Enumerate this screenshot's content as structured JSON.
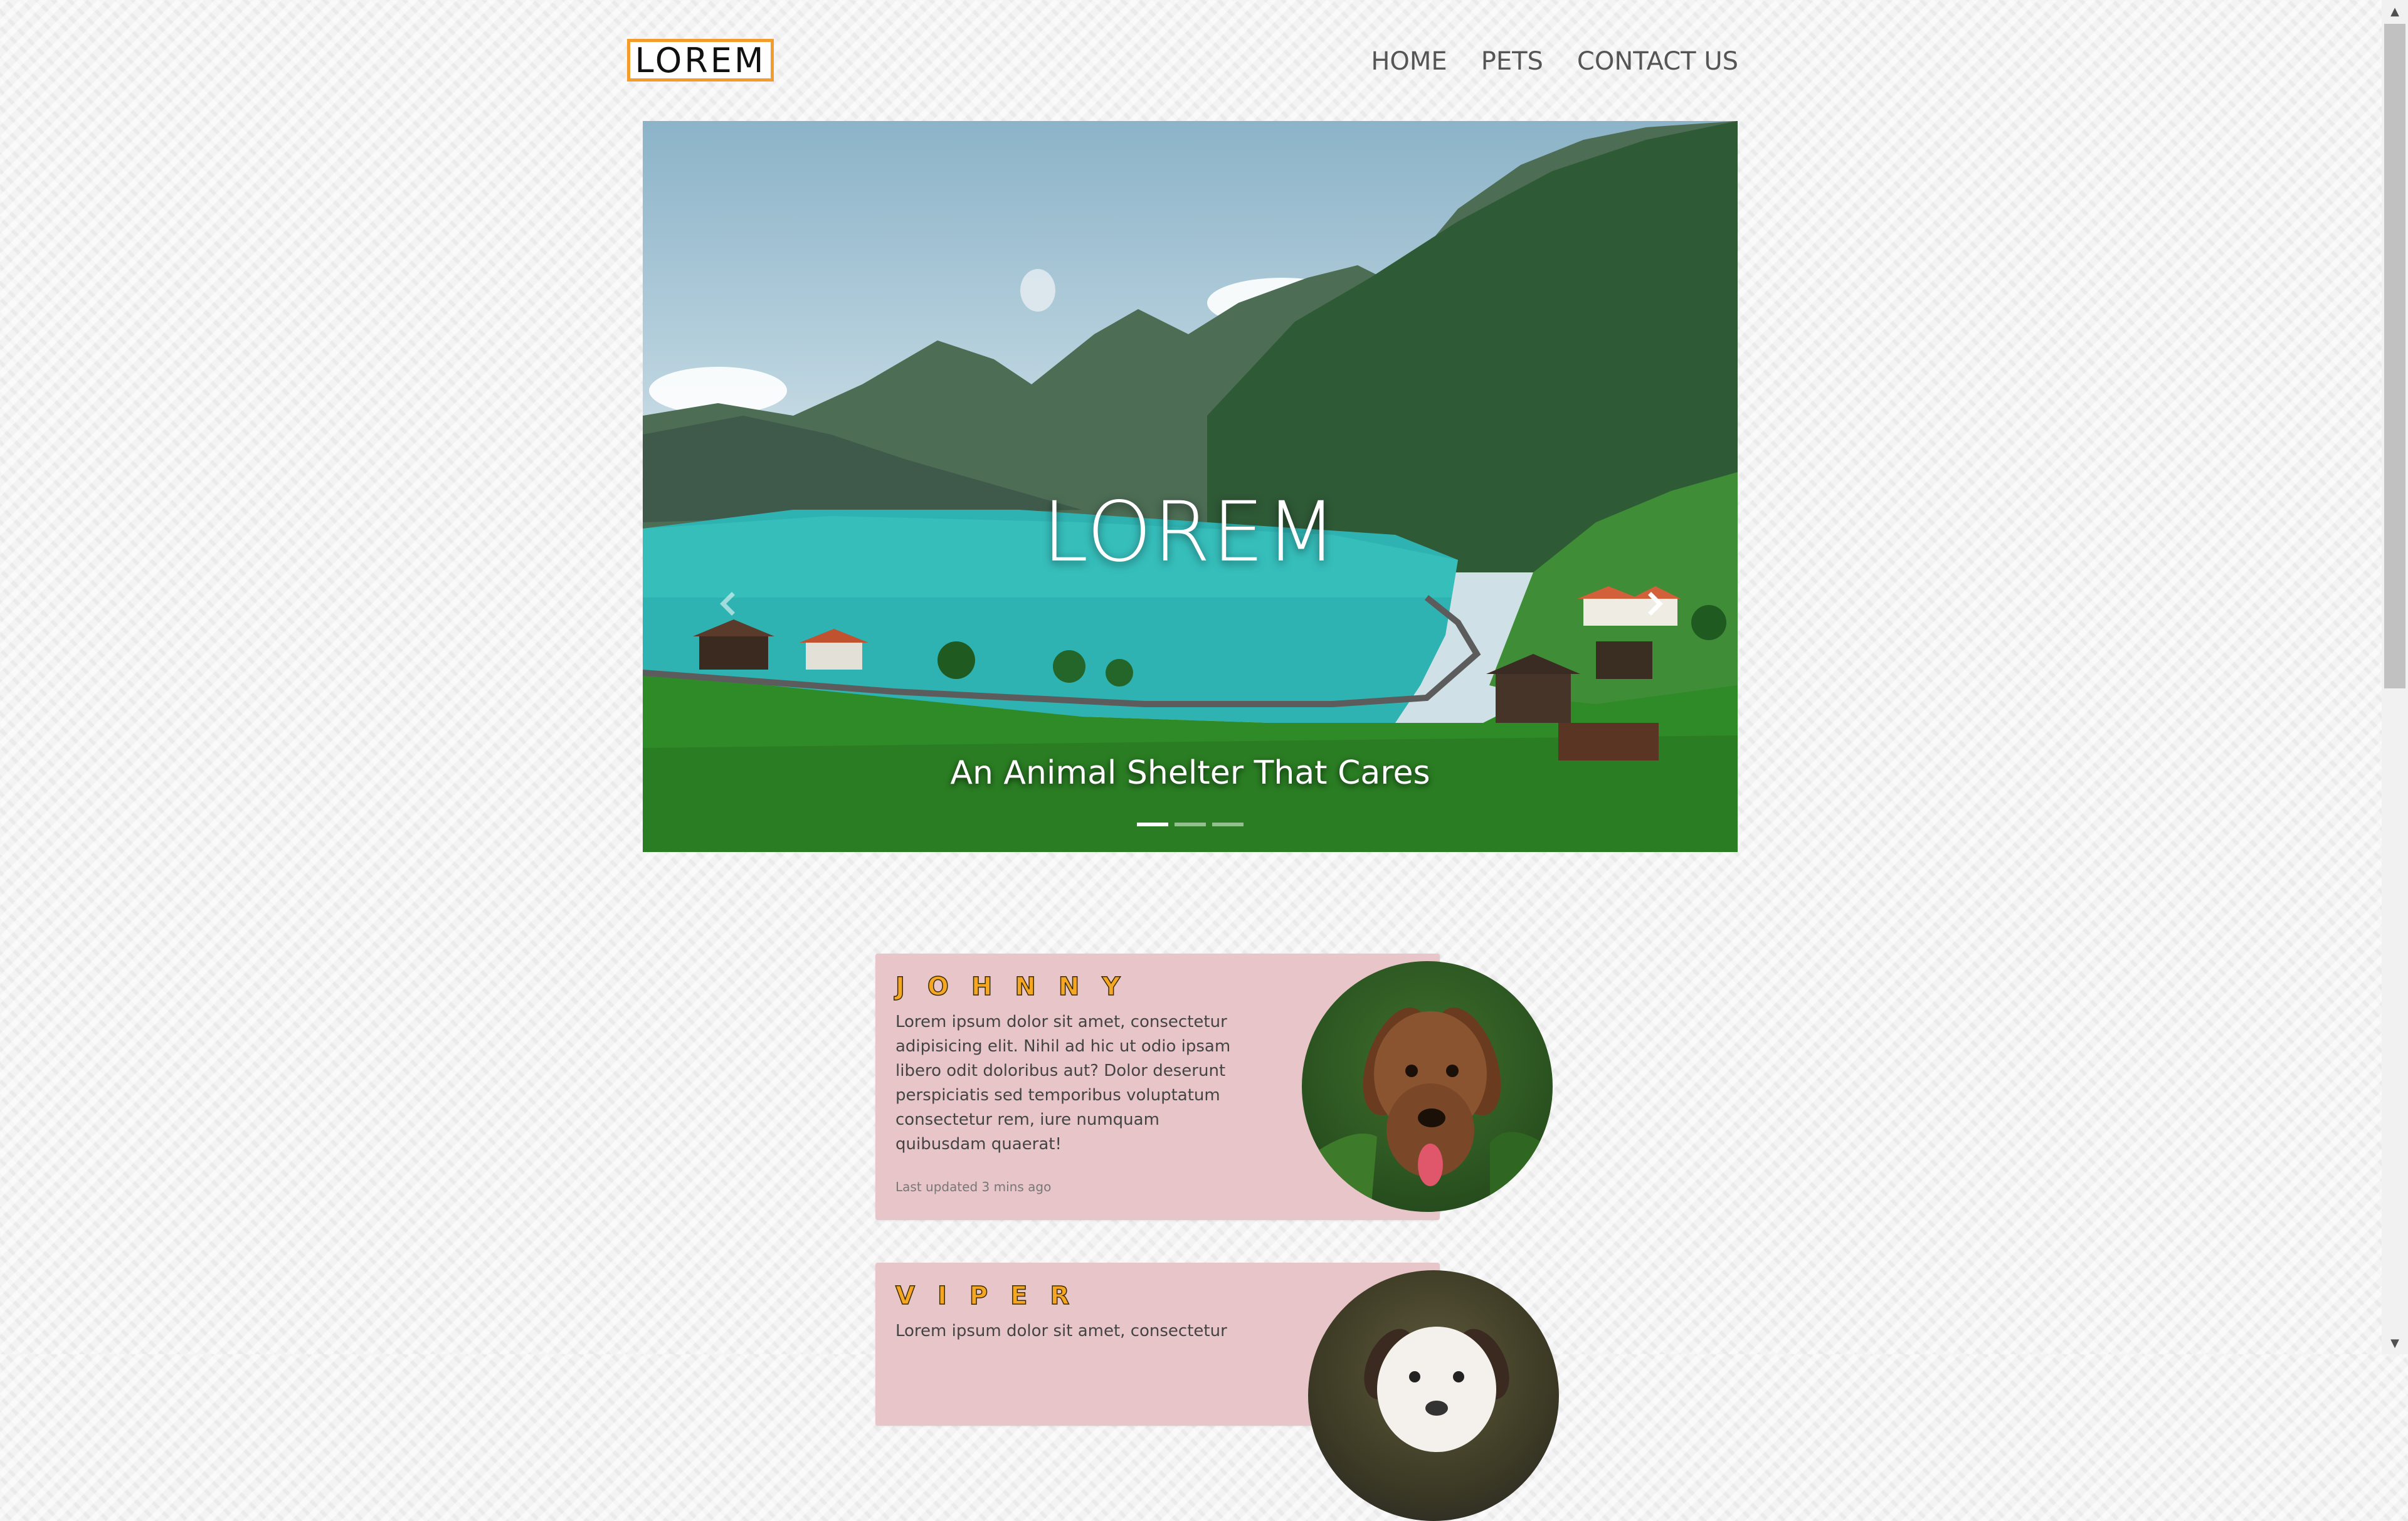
{
  "header": {
    "logo": "LOREM",
    "nav": [
      "HOME",
      "PETS",
      "CONTACT US"
    ]
  },
  "hero": {
    "title": "LOREM",
    "subtitle": "An Animal Shelter That Cares",
    "slide_count": 3,
    "active_slide": 1
  },
  "pets": [
    {
      "name": "JOHNNY",
      "description": "Lorem ipsum dolor sit amet, consectetur adipisicing elit. Nihil ad hic ut odio ipsam libero odit doloribus aut? Dolor deserunt perspiciatis sed temporibus voluptatum consectetur rem, iure numquam quibusdam quaerat!",
      "meta": "Last updated 3 mins ago"
    },
    {
      "name": "VIPER",
      "description": "Lorem ipsum dolor sit amet, consectetur"
    }
  ],
  "colors": {
    "accent": "#f39c2b",
    "card_bg": "#e7c5c9",
    "name_fill": "#f5a623"
  },
  "icons": {
    "prev": "chevron-left-icon",
    "next": "chevron-right-icon"
  }
}
